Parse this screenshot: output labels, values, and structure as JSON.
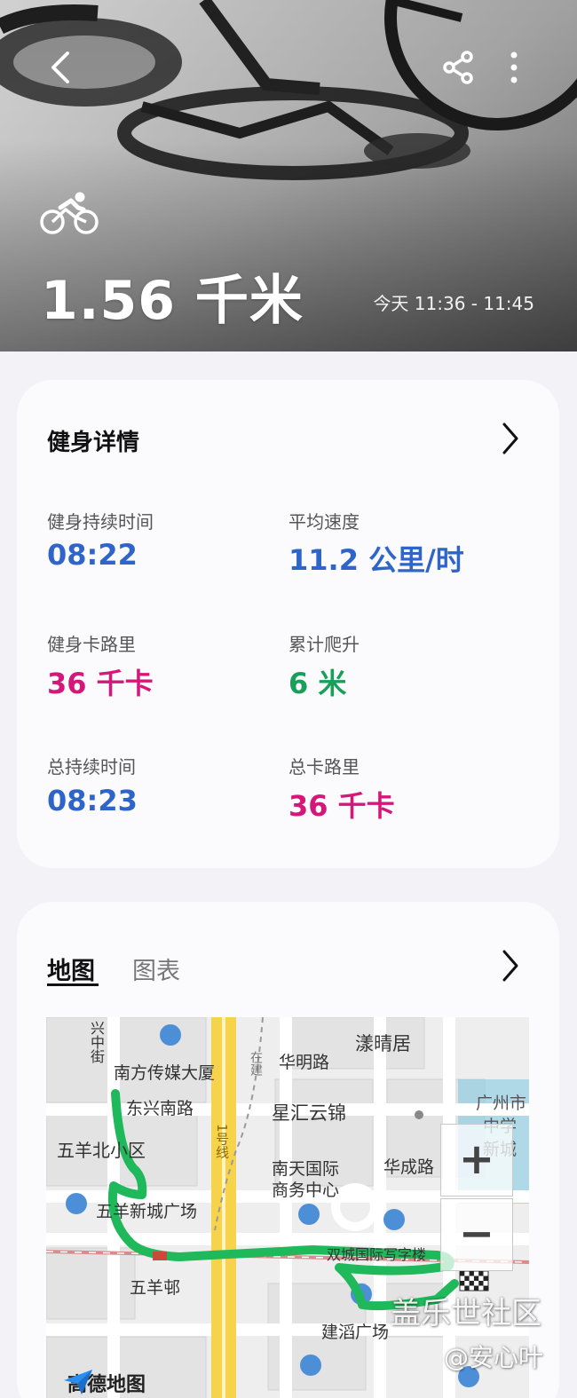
{
  "header": {
    "distance": "1.56 千米",
    "time_range": "今天 11:36 - 11:45",
    "activity_icon": "cycling-icon",
    "back_icon": "chevron-left-icon",
    "share_icon": "share-icon",
    "more_icon": "more-vertical-icon"
  },
  "details": {
    "title": "健身详情",
    "stats": [
      {
        "label": "健身持续时间",
        "value": "08:22",
        "color": "#2f65c8"
      },
      {
        "label": "平均速度",
        "value": "11.2 公里/时",
        "color": "#2f65c8"
      },
      {
        "label": "健身卡路里",
        "value": "36 千卡",
        "color": "#d3187a"
      },
      {
        "label": "累计爬升",
        "value": "6 米",
        "color": "#1a9e5a"
      },
      {
        "label": "总持续时间",
        "value": "08:23",
        "color": "#2f65c8"
      },
      {
        "label": "总卡路里",
        "value": "36 千卡",
        "color": "#d3187a"
      }
    ]
  },
  "map_section": {
    "tabs": [
      {
        "label": "地图",
        "active": true
      },
      {
        "label": "图表",
        "active": false
      }
    ],
    "zoom_in": "+",
    "zoom_out": "−",
    "provider": "高德地图",
    "route_color": "#1fb85a",
    "labels": {
      "l1": "南方传媒大厦",
      "l2": "华明路",
      "l3": "漾晴居",
      "l4": "东兴南路",
      "l5": "星汇云锦",
      "l6": "五羊北小区",
      "l7": "南天国际",
      "l8": "商务中心",
      "l9": "华成路",
      "l10": "五羊新城广场",
      "l11": "五羊邨",
      "l12": "建滔广场",
      "l13": "广州市",
      "l14": "中学",
      "l15": "新城",
      "l16": "兴中街",
      "l17": "双城国际写字楼",
      "l18": "1号线",
      "l19": "在建"
    }
  },
  "watermark": {
    "line1": "盖乐世社区",
    "line2": "@安心叶"
  }
}
